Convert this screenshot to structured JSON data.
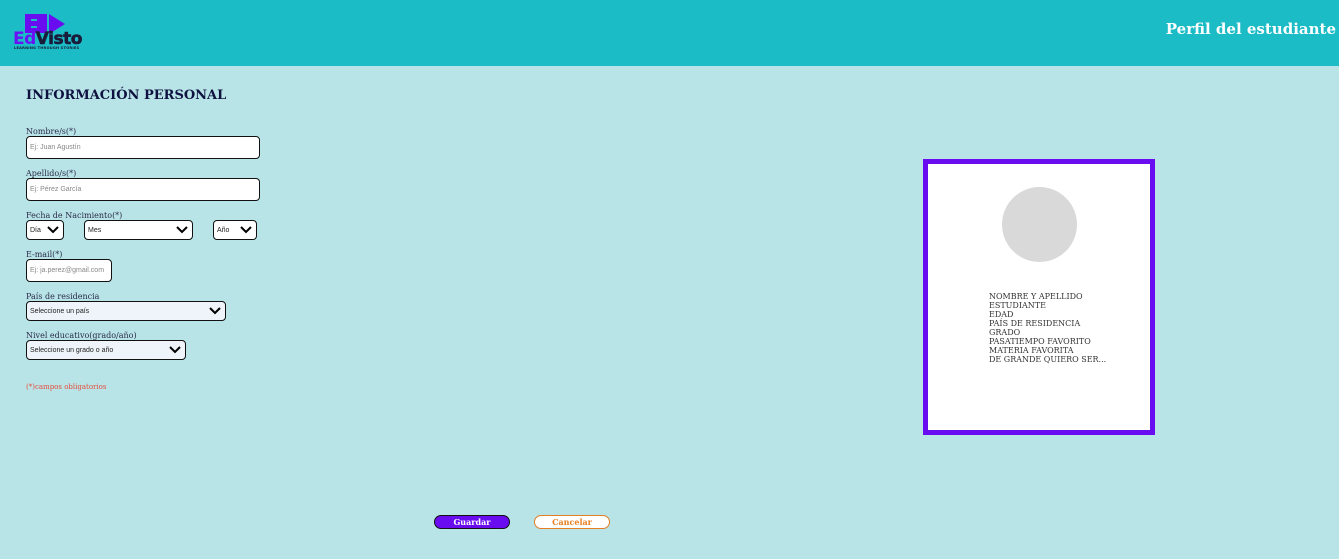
{
  "header": {
    "logo_ed": "Ed",
    "logo_visto": "Visto",
    "logo_tagline": "LEARNING THROUGH STORIES",
    "title": "Perfil del estudiante",
    "colors": {
      "bar": "#1cbcc6",
      "brand": "#6a0cf0"
    }
  },
  "form": {
    "section_title": "INFORMACIÓN PERSONAL",
    "first_name": {
      "label": "Nombre/s(*)",
      "placeholder": "Ej: Juan Agustín"
    },
    "last_name": {
      "label": "Apellido/s(*)",
      "placeholder": "Ej: Pérez García"
    },
    "birth_date": {
      "label": "Fecha de Nacimiento(*)",
      "day": "Día",
      "month": "Mes",
      "year": "Año"
    },
    "email": {
      "label": "E-mail(*)",
      "placeholder": "Ej: ja.perez@gmail.com"
    },
    "country": {
      "label": "País de residencia",
      "selected": "Seleccione un país"
    },
    "education": {
      "label": "Nivel educativo(grado/año)",
      "selected": "Seleccione un grado o año"
    },
    "required_note": "(*)campos obligatorios"
  },
  "actions": {
    "save": "Guardar",
    "cancel": "Cancelar"
  },
  "profile_card": {
    "lines": [
      "NOMBRE Y APELLIDO",
      "ESTUDIANTE",
      "EDAD",
      "PAÍS DE RESIDENCIA",
      "GRADO",
      "PASATIEMPO FAVORITO",
      "MATERIA FAVORITA",
      "DE GRANDE QUIERO SER..."
    ]
  }
}
